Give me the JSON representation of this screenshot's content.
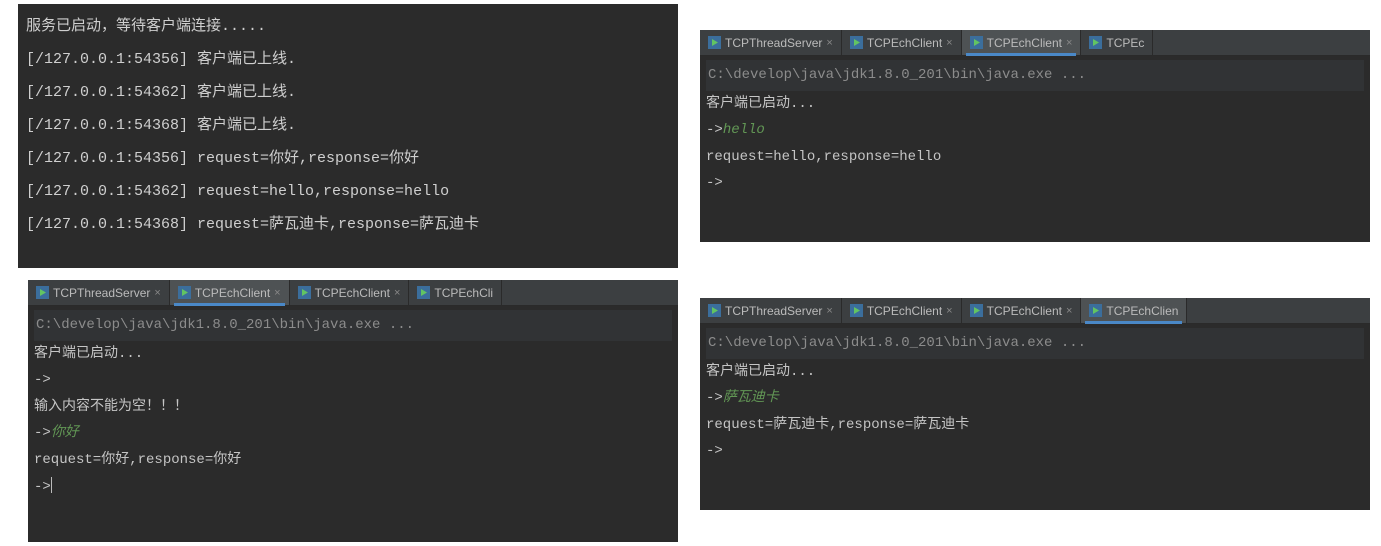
{
  "tab_labels": {
    "server": "TCPThreadServer",
    "client": "TCPEchClient",
    "client_trunc": "TCPEc",
    "client_trunc2": "TCPEchCli",
    "client_trunc3": "TCPEchClien"
  },
  "close_x": "×",
  "java_cmd": "C:\\develop\\java\\jdk1.8.0_201\\bin\\java.exe ...",
  "server_log": {
    "l0": "服务已启动，等待客户端连接.....",
    "l1": "[/127.0.0.1:54356] 客户端已上线.",
    "l2": "[/127.0.0.1:54362] 客户端已上线.",
    "l3": "[/127.0.0.1:54368] 客户端已上线.",
    "l4": "[/127.0.0.1:54356] request=你好,response=你好",
    "l5": "[/127.0.0.1:54362] request=hello,response=hello",
    "l6": "[/127.0.0.1:54368] request=萨瓦迪卡,response=萨瓦迪卡"
  },
  "client_started": "客户端已启动...",
  "prompt": "->",
  "p2": {
    "input": "hello",
    "resp": "request=hello,response=hello"
  },
  "p3": {
    "empty_err": "输入内容不能为空！！！",
    "input": "你好",
    "resp": "request=你好,response=你好"
  },
  "p4": {
    "input": "萨瓦迪卡",
    "resp": "request=萨瓦迪卡,response=萨瓦迪卡"
  }
}
